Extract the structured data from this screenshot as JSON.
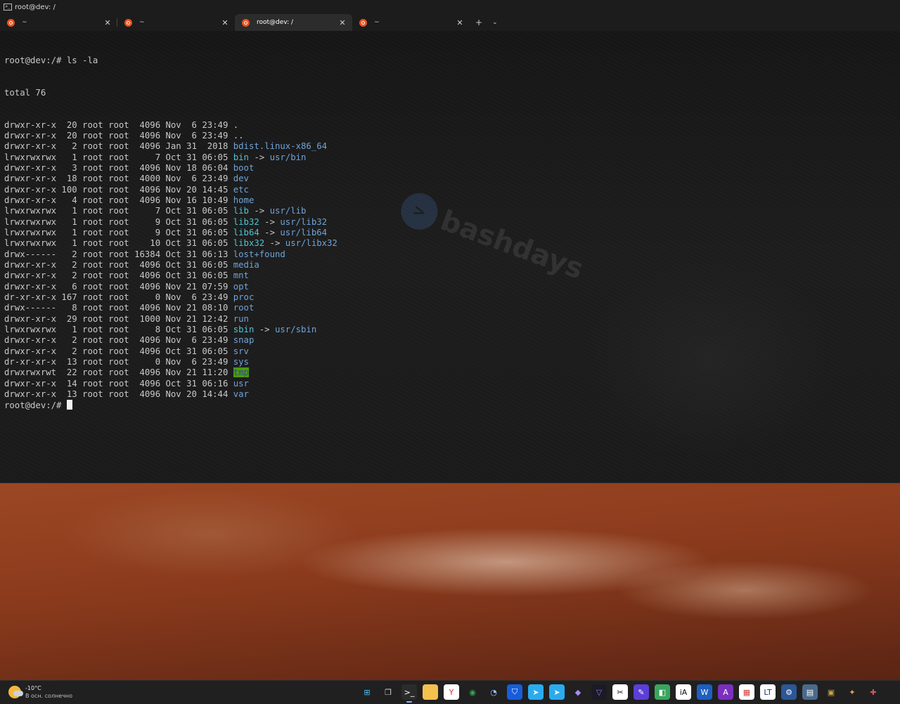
{
  "window": {
    "title": "root@dev: /"
  },
  "tabs": [
    {
      "label": "~",
      "active": false
    },
    {
      "label": "~",
      "active": false
    },
    {
      "label": "root@dev: /",
      "active": true
    },
    {
      "label": "~",
      "active": false
    }
  ],
  "tab_close_glyph": "✕",
  "new_tab_glyph": "+",
  "tab_menu_glyph": "⌄",
  "watermark_text": "bashdays",
  "terminal": {
    "prompt": "root@dev:/# ",
    "command": "ls -la",
    "total": "total 76",
    "entries": [
      {
        "meta": "drwxr-xr-x  20 root root  4096 Nov  6 23:49 ",
        "name": ".",
        "type": "plain"
      },
      {
        "meta": "drwxr-xr-x  20 root root  4096 Nov  6 23:49 ",
        "name": "..",
        "type": "plain"
      },
      {
        "meta": "drwxr-xr-x   2 root root  4096 Jan 31  2018 ",
        "name": "bdist.linux-x86_64",
        "type": "dir"
      },
      {
        "meta": "lrwxrwxrwx   1 root root     7 Oct 31 06:05 ",
        "name": "bin",
        "type": "link",
        "target": "usr/bin"
      },
      {
        "meta": "drwxr-xr-x   3 root root  4096 Nov 18 06:04 ",
        "name": "boot",
        "type": "dir"
      },
      {
        "meta": "drwxr-xr-x  18 root root  4000 Nov  6 23:49 ",
        "name": "dev",
        "type": "dir"
      },
      {
        "meta": "drwxr-xr-x 100 root root  4096 Nov 20 14:45 ",
        "name": "etc",
        "type": "dir"
      },
      {
        "meta": "drwxr-xr-x   4 root root  4096 Nov 16 10:49 ",
        "name": "home",
        "type": "dir"
      },
      {
        "meta": "lrwxrwxrwx   1 root root     7 Oct 31 06:05 ",
        "name": "lib",
        "type": "link",
        "target": "usr/lib"
      },
      {
        "meta": "lrwxrwxrwx   1 root root     9 Oct 31 06:05 ",
        "name": "lib32",
        "type": "link",
        "target": "usr/lib32"
      },
      {
        "meta": "lrwxrwxrwx   1 root root     9 Oct 31 06:05 ",
        "name": "lib64",
        "type": "link",
        "target": "usr/lib64"
      },
      {
        "meta": "lrwxrwxrwx   1 root root    10 Oct 31 06:05 ",
        "name": "libx32",
        "type": "link",
        "target": "usr/libx32"
      },
      {
        "meta": "drwx------   2 root root 16384 Oct 31 06:13 ",
        "name": "lost+found",
        "type": "dir"
      },
      {
        "meta": "drwxr-xr-x   2 root root  4096 Oct 31 06:05 ",
        "name": "media",
        "type": "dir"
      },
      {
        "meta": "drwxr-xr-x   2 root root  4096 Oct 31 06:05 ",
        "name": "mnt",
        "type": "dir"
      },
      {
        "meta": "drwxr-xr-x   6 root root  4096 Nov 21 07:59 ",
        "name": "opt",
        "type": "dir"
      },
      {
        "meta": "dr-xr-xr-x 167 root root     0 Nov  6 23:49 ",
        "name": "proc",
        "type": "dir"
      },
      {
        "meta": "drwx------   8 root root  4096 Nov 21 08:10 ",
        "name": "root",
        "type": "dir"
      },
      {
        "meta": "drwxr-xr-x  29 root root  1000 Nov 21 12:42 ",
        "name": "run",
        "type": "dir"
      },
      {
        "meta": "lrwxrwxrwx   1 root root     8 Oct 31 06:05 ",
        "name": "sbin",
        "type": "link",
        "target": "usr/sbin"
      },
      {
        "meta": "drwxr-xr-x   2 root root  4096 Nov  6 23:49 ",
        "name": "snap",
        "type": "dir"
      },
      {
        "meta": "drwxr-xr-x   2 root root  4096 Oct 31 06:05 ",
        "name": "srv",
        "type": "dir"
      },
      {
        "meta": "dr-xr-xr-x  13 root root     0 Nov  6 23:49 ",
        "name": "sys",
        "type": "dir"
      },
      {
        "meta": "drwxrwxrwt  22 root root  4096 Nov 21 11:20 ",
        "name": "tmp",
        "type": "sticky"
      },
      {
        "meta": "drwxr-xr-x  14 root root  4096 Oct 31 06:16 ",
        "name": "usr",
        "type": "dir"
      },
      {
        "meta": "drwxr-xr-x  13 root root  4096 Nov 20 14:44 ",
        "name": "var",
        "type": "dir"
      }
    ],
    "arrow": " -> ",
    "final_prompt": "root@dev:/# "
  },
  "colors": {
    "dir": "#6fa3d8",
    "link": "#4fc4d4",
    "sticky_bg": "#4e9a06",
    "ubuntu": "#e95420"
  },
  "taskbar": {
    "weather_temp": "-10°C",
    "weather_condition": "В осн. солнечно",
    "apps": [
      {
        "name": "start-icon",
        "glyph": "⊞",
        "bg": "transparent",
        "fg": "#4cc2ff"
      },
      {
        "name": "task-view-icon",
        "glyph": "❐",
        "bg": "transparent",
        "fg": "#d0d0d0"
      },
      {
        "name": "terminal-app-icon",
        "glyph": ">_",
        "bg": "#2b2b2b",
        "fg": "#ffffff",
        "active": true
      },
      {
        "name": "file-explorer-icon",
        "glyph": "▬",
        "bg": "#f2c14e",
        "fg": "#f2c14e"
      },
      {
        "name": "yandex-browser-icon",
        "glyph": "Y",
        "bg": "#ffffff",
        "fg": "#e22b2b"
      },
      {
        "name": "chrome-icon",
        "glyph": "◉",
        "bg": "transparent",
        "fg": "#34a853"
      },
      {
        "name": "clock-app-icon",
        "glyph": "◔",
        "bg": "transparent",
        "fg": "#9ec6ff"
      },
      {
        "name": "bitwarden-icon",
        "glyph": "⛉",
        "bg": "#175ddc",
        "fg": "#ffffff"
      },
      {
        "name": "telegram-icon",
        "glyph": "➤",
        "bg": "#2aabee",
        "fg": "#ffffff"
      },
      {
        "name": "telegram-alt-icon",
        "glyph": "➤",
        "bg": "#2aabee",
        "fg": "#ffffff"
      },
      {
        "name": "obsidian-icon",
        "glyph": "◆",
        "bg": "transparent",
        "fg": "#a88bfa"
      },
      {
        "name": "proton-vpn-icon",
        "glyph": "▽",
        "bg": "#1c1b24",
        "fg": "#8a6cff"
      },
      {
        "name": "capcut-icon",
        "glyph": "✂",
        "bg": "#ffffff",
        "fg": "#111111"
      },
      {
        "name": "pen-app-icon",
        "glyph": "✎",
        "bg": "#5b3fd6",
        "fg": "#ffffff"
      },
      {
        "name": "green-app-icon",
        "glyph": "◧",
        "bg": "#3aa55d",
        "fg": "#ffffff"
      },
      {
        "name": "ia-app-icon",
        "glyph": "iA",
        "bg": "#ffffff",
        "fg": "#111111"
      },
      {
        "name": "word-icon",
        "glyph": "W",
        "bg": "#1f5fbf",
        "fg": "#ffffff"
      },
      {
        "name": "affinity-icon",
        "glyph": "A",
        "bg": "#7b2fbf",
        "fg": "#ffffff"
      },
      {
        "name": "calendar-app-icon",
        "glyph": "▦",
        "bg": "#ffffff",
        "fg": "#d04040"
      },
      {
        "name": "lt-app-icon",
        "glyph": "LT",
        "bg": "#ffffff",
        "fg": "#1a3a6a"
      },
      {
        "name": "settings-gear-icon",
        "glyph": "⚙",
        "bg": "#2b5797",
        "fg": "#ffffff"
      },
      {
        "name": "calculator-icon",
        "glyph": "▤",
        "bg": "#4a6a8a",
        "fg": "#ffffff"
      },
      {
        "name": "chip-app-icon",
        "glyph": "▣",
        "bg": "transparent",
        "fg": "#c8a24a"
      },
      {
        "name": "fox-app-icon",
        "glyph": "✦",
        "bg": "transparent",
        "fg": "#e0a060"
      },
      {
        "name": "photo-app-icon",
        "glyph": "✚",
        "bg": "transparent",
        "fg": "#d05a5a"
      }
    ]
  }
}
